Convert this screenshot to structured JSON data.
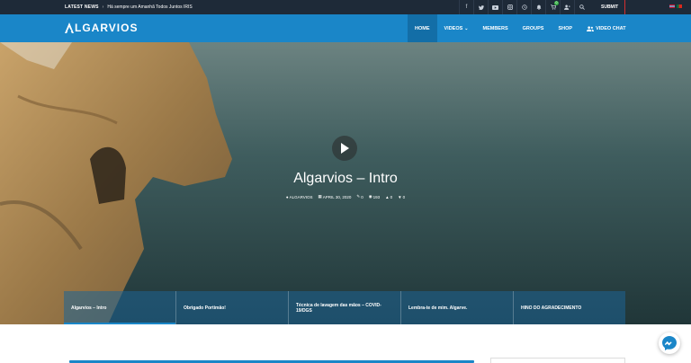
{
  "topbar": {
    "latest_news_label": "LATEST NEWS",
    "news_headline": "Há sempre um Amanhã Todos Juntos IRIS",
    "icons": [
      "facebook-icon",
      "twitter-icon",
      "youtube-icon",
      "instagram-icon",
      "history-icon",
      "bell-icon",
      "cart-icon",
      "add-user-icon",
      "search-icon"
    ],
    "cart_count": "0",
    "submit_label": "SUBMIT"
  },
  "nav": {
    "logo_text": "LGARVIOS",
    "items": [
      {
        "label": "HOME"
      },
      {
        "label": "VIDEOS"
      },
      {
        "label": "MEMBERS"
      },
      {
        "label": "GROUPS"
      },
      {
        "label": "SHOP"
      },
      {
        "label": "VIDEO CHAT"
      }
    ]
  },
  "hero": {
    "title": "Algarvios – Intro",
    "author": "ALGARVIOS",
    "date": "APRIL 30, 2020",
    "comments": "0",
    "views": "193",
    "likes": "0",
    "dislikes": "0"
  },
  "tabs": [
    {
      "label": "Algarvios – Intro"
    },
    {
      "label": "Obrigado Portimão!"
    },
    {
      "label": "Técnica de lavagem das mãos – COVID-19/DGS"
    },
    {
      "label": "Lembra-te de mim. Algarve."
    },
    {
      "label": "HINO DO AGRADECIMENTO"
    }
  ],
  "colors": {
    "brand": "#1a86c8",
    "topbar": "#1e2a38"
  }
}
